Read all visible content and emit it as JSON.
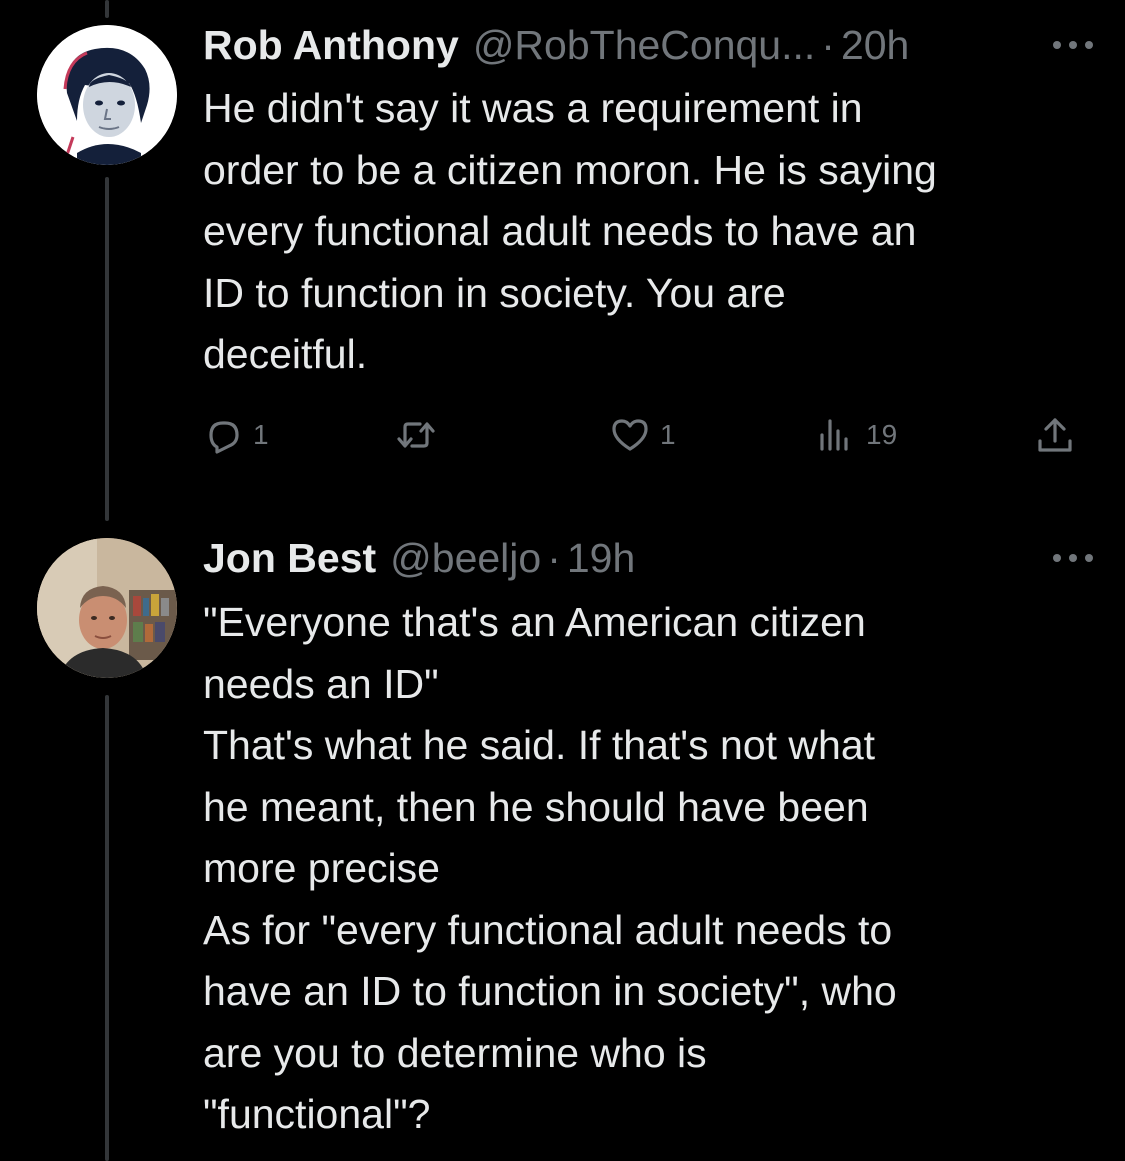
{
  "tweets": [
    {
      "name": "Rob Anthony",
      "handle": "@RobTheConqu...",
      "separator": "·",
      "time": "20h",
      "lines": [
        "He didn't say it was a requirement in",
        "order to be a citizen moron. He is saying",
        "every functional adult needs to have an",
        "ID to function in society. You are",
        "deceitful."
      ],
      "actions": {
        "replies": "1",
        "retweets": "",
        "likes": "1",
        "views": "19"
      }
    },
    {
      "name": "Jon Best",
      "handle": "@beeljo",
      "separator": "·",
      "time": "19h",
      "lines": [
        "\"Everyone that's an American citizen",
        "needs an ID\"",
        "That's what he said. If that's not what",
        "he meant, then he should have been",
        "more precise",
        "As for \"every functional adult needs to",
        "have an ID to function in society\", who",
        "are you to determine who is",
        "\"functional\"?"
      ]
    }
  ],
  "icons": {
    "more": "more-horizontal-icon",
    "reply": "reply-icon",
    "retweet": "retweet-icon",
    "like": "heart-icon",
    "views": "views-chart-icon",
    "share": "share-upload-icon"
  },
  "colors": {
    "background": "#000000",
    "primary_text": "#e7e9ea",
    "secondary_text": "#71767b",
    "thread_line": "#333639"
  }
}
